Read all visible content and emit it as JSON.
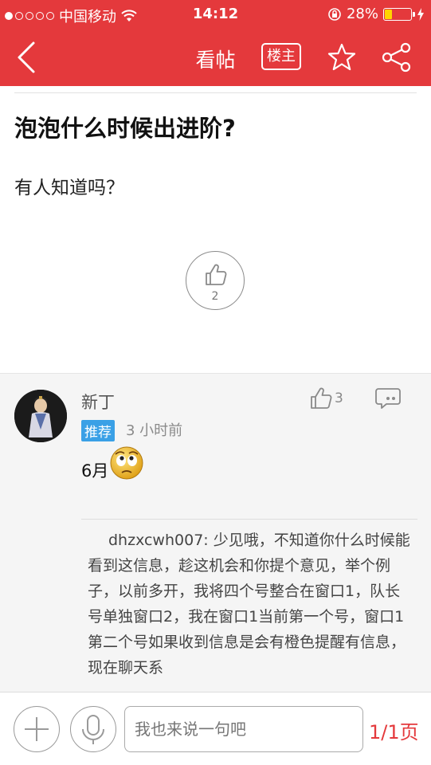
{
  "status": {
    "carrier": "中国移动",
    "time": "14:12",
    "battery": "28%",
    "battery_level": 0.28,
    "signal_bars_filled": 1,
    "signal_bars_total": 5
  },
  "nav": {
    "title": "看帖",
    "louzhu_label": "楼主",
    "back_icon": "back-chevron-icon",
    "star_icon": "star-icon",
    "share_icon": "share-icon"
  },
  "post": {
    "title": "泡泡什么时候出进阶?",
    "body": "有人知道吗？",
    "like_count": "2"
  },
  "reply": {
    "author": "新丁",
    "badge": "推荐",
    "time": "3 小时前",
    "like_count": "3",
    "content": "6月",
    "quote": "dhzxcwh007: 少见哦，不知道你什么时候能看到这信息，趁这机会和你提个意见，举个例子，以前多开，我将四个号整合在窗口1，队长号单独窗口2，我在窗口1当前第一个号，窗口1第二个号如果收到信息是会有橙色提醒有信息，现在聊天系"
  },
  "bottom": {
    "input_placeholder": "我也来说一句吧",
    "page_indicator": "1/1页"
  },
  "colors": {
    "brand_red": "#e4393c",
    "badge_blue": "#3aa0e6"
  }
}
